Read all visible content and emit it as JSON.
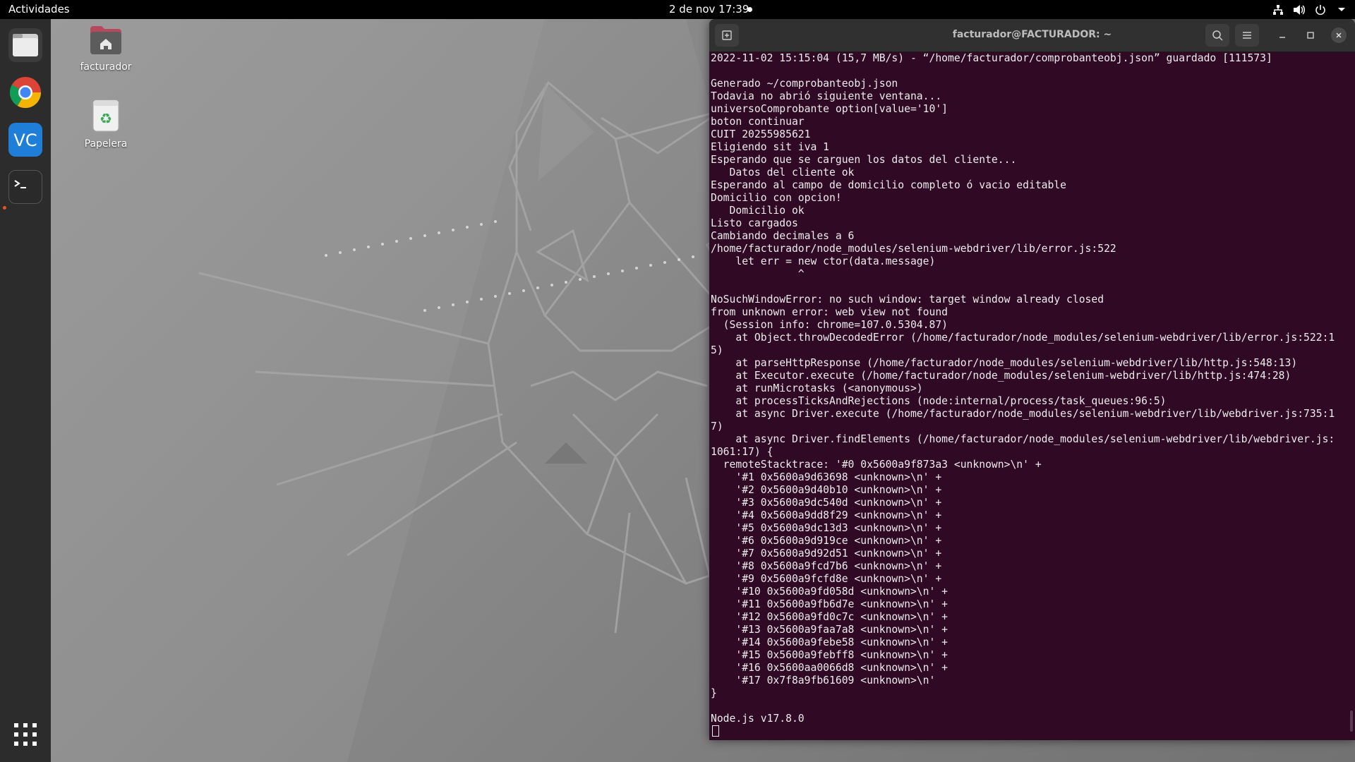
{
  "topbar": {
    "activities_label": "Actividades",
    "clock": "2 de nov  17:39",
    "tray_icons": [
      "network-icon",
      "volume-icon",
      "power-icon",
      "chevron-down-icon"
    ]
  },
  "dock": {
    "items": [
      {
        "name": "files-app",
        "icon": "folder-icon"
      },
      {
        "name": "chrome-app",
        "icon": "chrome-icon"
      },
      {
        "name": "vscode-app",
        "icon": "vscode-icon"
      },
      {
        "name": "terminal-app",
        "icon": "terminal-icon",
        "running": true
      }
    ],
    "apps_grid_icon": "grid-icon"
  },
  "desktop": {
    "icons": [
      {
        "label": "facturador",
        "icon": "home-folder-icon"
      },
      {
        "label": "Papelera",
        "icon": "trash-icon"
      }
    ]
  },
  "terminal": {
    "title": "facturador@FACTURADOR: ~",
    "lines": [
      "2022-11-02 15:15:04 (15,7 MB/s) - “/home/facturador/comprobanteobj.json” guardado [111573]",
      "",
      "Generado ~/comprobanteobj.json",
      "Todavia no abrió siguiente ventana...",
      "universoComprobante option[value='10']",
      "boton continuar",
      "CUIT 20255985621",
      "Eligiendo sit iva 1",
      "Esperando que se carguen los datos del cliente...",
      "   Datos del cliente ok",
      "Esperando al campo de domicilio completo ó vacio editable",
      "Domicilio con opcion!",
      "   Domicilio ok",
      "Listo cargados",
      "Cambiando decimales a 6",
      "/home/facturador/node_modules/selenium-webdriver/lib/error.js:522",
      "    let err = new ctor(data.message)",
      "              ^",
      "",
      "NoSuchWindowError: no such window: target window already closed",
      "from unknown error: web view not found",
      "  (Session info: chrome=107.0.5304.87)",
      "    at Object.throwDecodedError (/home/facturador/node_modules/selenium-webdriver/lib/error.js:522:1",
      "5)",
      "    at parseHttpResponse (/home/facturador/node_modules/selenium-webdriver/lib/http.js:548:13)",
      "    at Executor.execute (/home/facturador/node_modules/selenium-webdriver/lib/http.js:474:28)",
      "    at runMicrotasks (<anonymous>)",
      "    at processTicksAndRejections (node:internal/process/task_queues:96:5)",
      "    at async Driver.execute (/home/facturador/node_modules/selenium-webdriver/lib/webdriver.js:735:1",
      "7)",
      "    at async Driver.findElements (/home/facturador/node_modules/selenium-webdriver/lib/webdriver.js:",
      "1061:17) {",
      "  remoteStacktrace: '#0 0x5600a9f873a3 <unknown>\\n' +",
      "    '#1 0x5600a9d63698 <unknown>\\n' +",
      "    '#2 0x5600a9d40b10 <unknown>\\n' +",
      "    '#3 0x5600a9dc540d <unknown>\\n' +",
      "    '#4 0x5600a9dd8f29 <unknown>\\n' +",
      "    '#5 0x5600a9dc13d3 <unknown>\\n' +",
      "    '#6 0x5600a9d919ce <unknown>\\n' +",
      "    '#7 0x5600a9d92d51 <unknown>\\n' +",
      "    '#8 0x5600a9fcd7b6 <unknown>\\n' +",
      "    '#9 0x5600a9fcfd8e <unknown>\\n' +",
      "    '#10 0x5600a9fd058d <unknown>\\n' +",
      "    '#11 0x5600a9fb6d7e <unknown>\\n' +",
      "    '#12 0x5600a9fd0c7c <unknown>\\n' +",
      "    '#13 0x5600a9faa7a8 <unknown>\\n' +",
      "    '#14 0x5600a9febe58 <unknown>\\n' +",
      "    '#15 0x5600a9febff8 <unknown>\\n' +",
      "    '#16 0x5600aa0066d8 <unknown>\\n' +",
      "    '#17 0x7f8a9fb61609 <unknown>\\n'",
      "}",
      "",
      "Node.js v17.8.0"
    ]
  },
  "colors": {
    "terminal_bg": "#300a24",
    "terminal_fg": "#ececec",
    "accent": "#e95420"
  }
}
